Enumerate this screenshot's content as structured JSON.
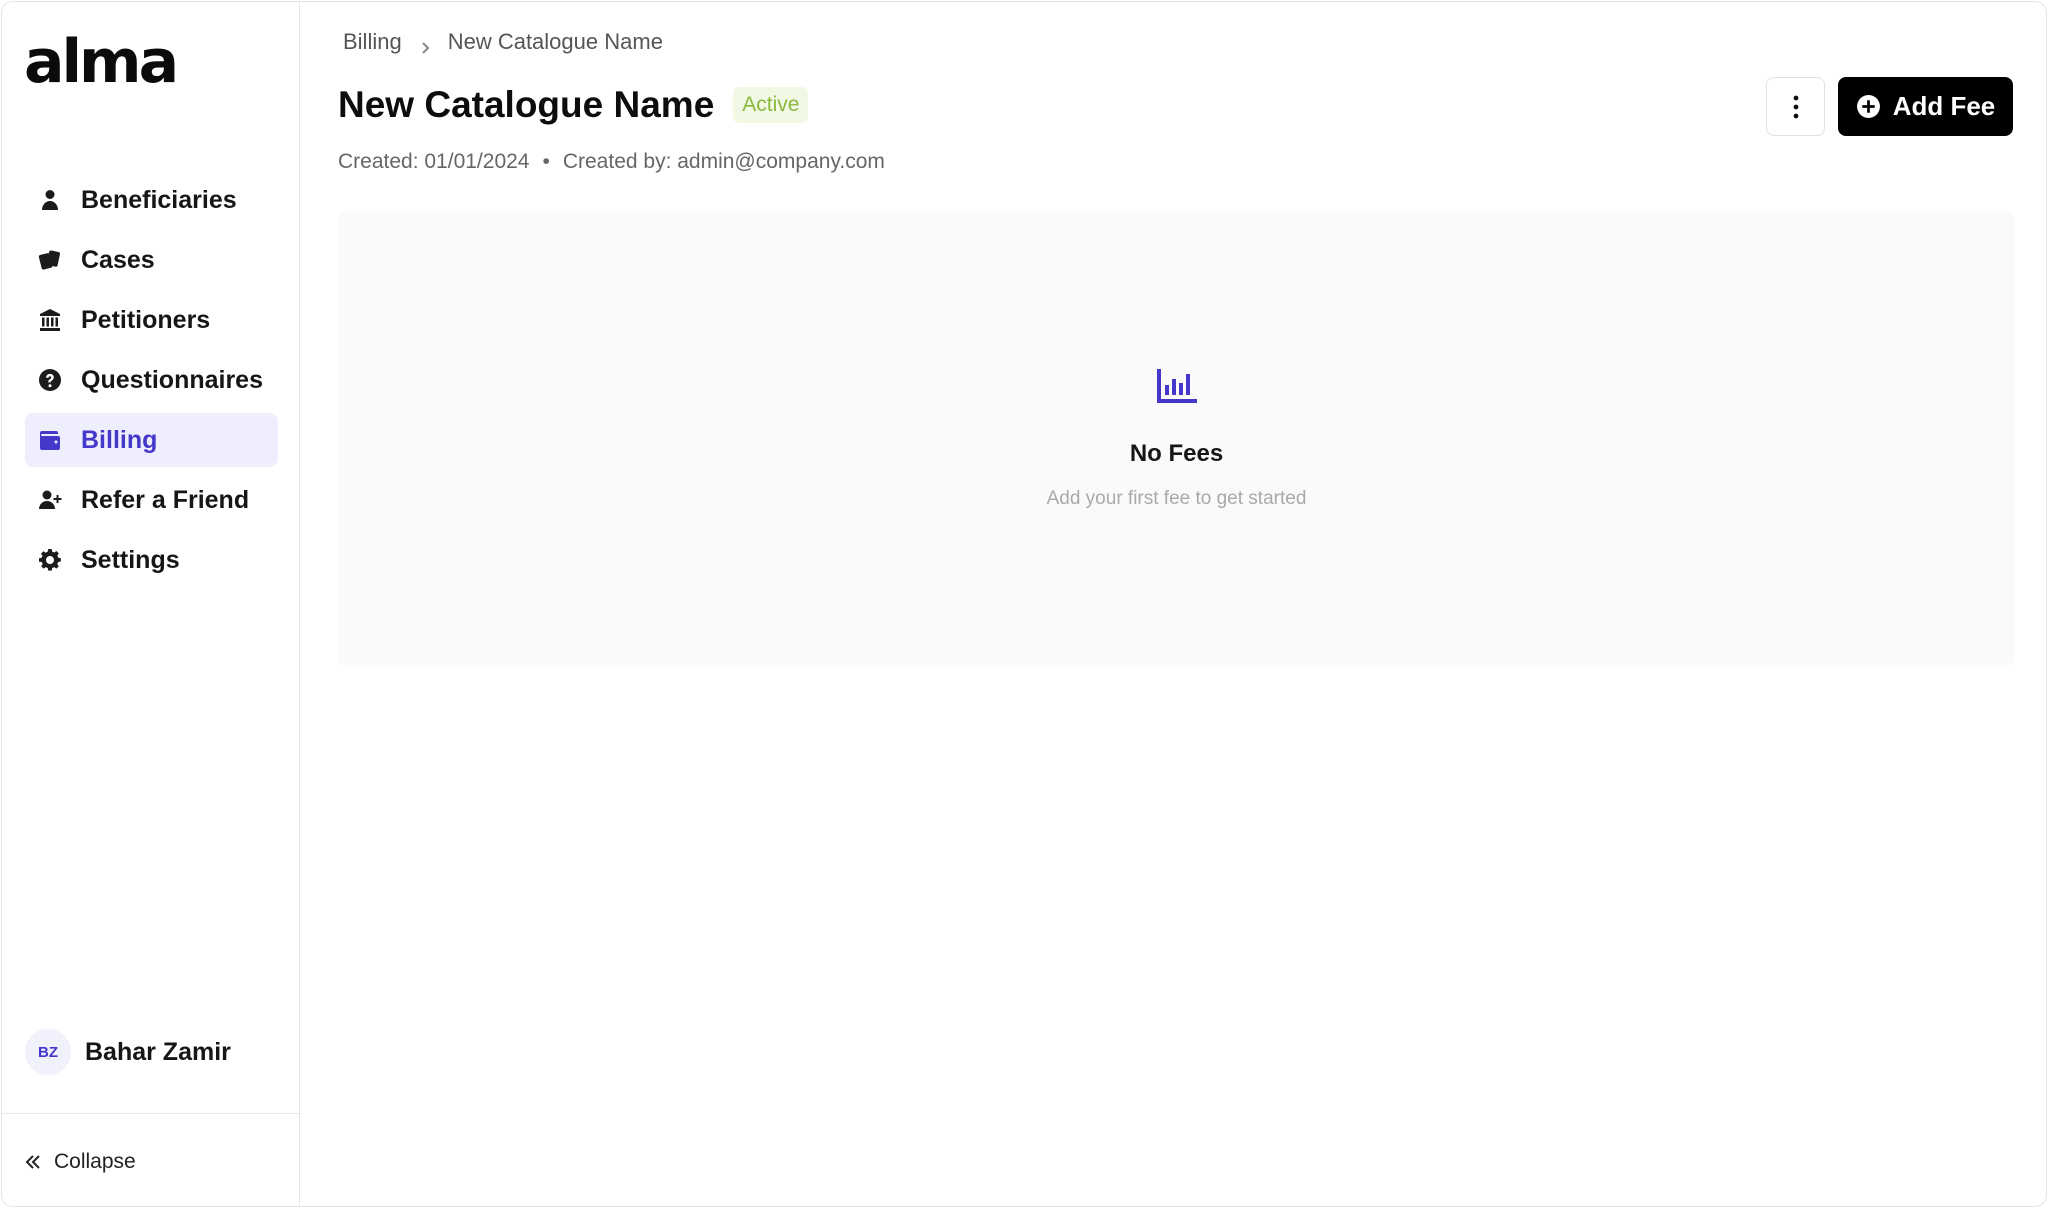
{
  "brand": {
    "logo_text": "alma",
    "accent_color": "#4338ca"
  },
  "sidebar": {
    "items": [
      {
        "label": "Beneficiaries",
        "icon": "person-icon",
        "active": false
      },
      {
        "label": "Cases",
        "icon": "cards-icon",
        "active": false
      },
      {
        "label": "Petitioners",
        "icon": "bank-icon",
        "active": false
      },
      {
        "label": "Questionnaires",
        "icon": "question-circle-icon",
        "active": false
      },
      {
        "label": "Billing",
        "icon": "wallet-icon",
        "active": true
      },
      {
        "label": "Refer a Friend",
        "icon": "user-plus-icon",
        "active": false
      },
      {
        "label": "Settings",
        "icon": "gear-icon",
        "active": false
      }
    ],
    "user": {
      "initials": "BZ",
      "name": "Bahar Zamir"
    },
    "collapse_label": "Collapse"
  },
  "header": {
    "breadcrumb": [
      "Billing",
      "New Catalogue Name"
    ],
    "title": "New Catalogue Name",
    "status": "Active",
    "status_color": "#8ab83d",
    "created": "Created: 01/01/2024",
    "created_by": "Created by: admin@company.com",
    "add_button_label": "Add Fee"
  },
  "empty_state": {
    "icon": "bar-chart-icon",
    "title": "No Fees",
    "subtitle": "Add your first fee to get started"
  }
}
